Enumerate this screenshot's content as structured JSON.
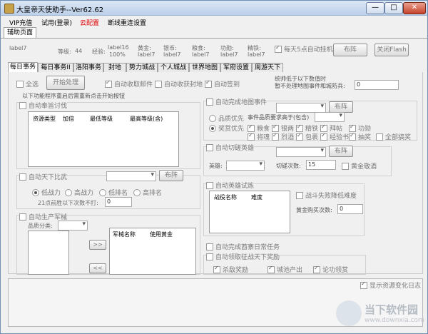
{
  "window": {
    "title": "大皇帝天使助手--Ver62.62",
    "btn_min": "—",
    "btn_max": "□",
    "btn_close": "✕"
  },
  "menu": [
    "VIP充值",
    "试用(登录)",
    "云配置",
    "断线重连设置"
  ],
  "outer_tab": "辅助页面",
  "stats": {
    "name": "label7",
    "level_label": "等级:",
    "level": "44",
    "exp_label": "经验:",
    "exp": "label16",
    "exp_pct": "100%",
    "gold_label": "黄金:",
    "gold": "label7",
    "silver_label": "银币:",
    "silver": "label7",
    "food_label": "粮食:",
    "food": "label7",
    "merit_label": "功勋:",
    "merit": "label7",
    "iron_label": "精铁:",
    "iron": "label7"
  },
  "top_right": {
    "auto_hang": "每天5点自动挂机",
    "btn_layout": "布阵",
    "btn_flash": "关闭Flash"
  },
  "inner_tabs": [
    "每日事务",
    "每日事务II",
    "洛阳事务",
    "封地",
    "势力城战",
    "个人城战",
    "世界地图",
    "军府设置",
    "周游天下"
  ],
  "row1": {
    "select_all": "全选",
    "start_btn": "开始处理",
    "collect_mail": "自动收取邮件",
    "collect_fief": "自动收获封地",
    "auto_sign": "自动签到"
  },
  "notice": {
    "line1": "统帅低于以下数值时",
    "line2": "暂不处理地图事件和城防兵:",
    "value": "0"
  },
  "restart_note": "以下功能程序重启后需重新点击开始按钮",
  "auto_expedition": {
    "label": "自动奉旨讨伐",
    "cols": [
      "资源类型",
      "加倍",
      "最低等级",
      "最高等级(含)"
    ]
  },
  "auto_compare": {
    "label": "自动天下比武",
    "btn": "布阵",
    "r1": "低战力",
    "r2": "高战力",
    "r3": "低排名",
    "r4": "高排名",
    "note": "21点前胜以下次数不打:",
    "value": "0"
  },
  "auto_produce": {
    "label": "自动生产军械",
    "quality_label": "品质分类:",
    "cols": [
      "军械名称",
      "使用黄金"
    ],
    "arrow_right": ">>",
    "arrow_left": "<<"
  },
  "map_event": {
    "label": "自动完成地图事件",
    "btn": "布阵",
    "r_quality": "品质优先",
    "event_quality_label": "事件品质要求高于(包含)",
    "r_reward": "奖赏优先",
    "items": [
      "粮食",
      "银两",
      "精铁",
      "拜帖",
      "功勋",
      "将魂",
      "烈酒",
      "包裹",
      "经验书",
      "抽奖"
    ],
    "select_all": "全部搞奖"
  },
  "auto_duel": {
    "label": "自动切磋英雄",
    "btn": "布阵",
    "hero_label": "英雄:",
    "count_label": "切磋次数:",
    "count_value": "15",
    "gold_wine": "黄金敬酒"
  },
  "hero_trial": {
    "label": "自动英雄试炼",
    "cols": [
      "战役名称",
      "难度"
    ],
    "fail_stop": "战斗失败降低难度",
    "gold_buy_label": "黄金购买次数:",
    "gold_buy_value": "0"
  },
  "other": {
    "daily_tasks": "自动完成酋寨日常任务",
    "conquer_reward": "自动领取征战天下奖励",
    "sub1": "杀敌奖励",
    "sub2": "城池产出",
    "sub3": "论功领赏"
  },
  "bottom": {
    "show_log": "显示资源变化日志"
  },
  "watermark": {
    "text1": "当下软件园",
    "text2": "www.downxia.com"
  }
}
